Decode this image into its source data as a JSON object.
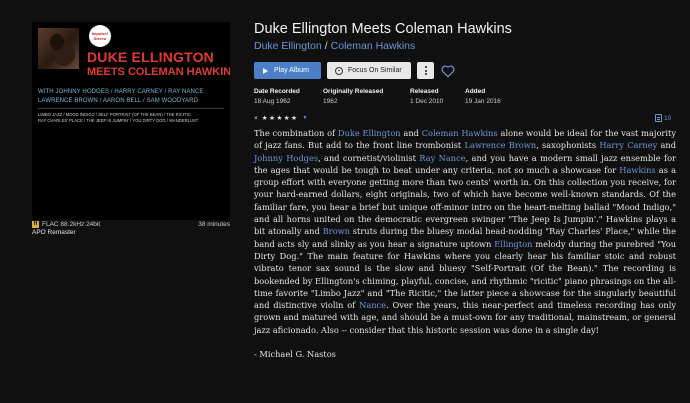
{
  "album": {
    "title": "Duke Ellington Meets Coleman Hawkins",
    "artist_1": "Duke Ellington",
    "artist_separator": "/",
    "artist_2": "Coleman Hawkins"
  },
  "cover": {
    "badge": "Impulse! Stereo",
    "title_line_1": "DUKE ELLINGTON",
    "title_line_2": "MEETS COLEMAN HAWKINS",
    "personnel_line_1": "WITH JOHNNY HODGES / HARRY CARNEY / RAY NANCE",
    "personnel_line_2": "LAWRENCE BROWN / AARON BELL / SAM WOODYARD",
    "tracks_line_1": "LIMBO JAZZ / MOOD INDIGO / SELF PORTRAIT (OF THE BEAN) / THE RICITIC",
    "tracks_line_2": "RAY CHARLES' PLACE / THE JEEP IS JUMPIN' / YOU DIRTY DOG / WANDERLUST"
  },
  "quality": {
    "hires_badge": "H",
    "format": "FLAC 88.2kHz 24bit",
    "duration": "38 minutes"
  },
  "version_label": "APO Remaster",
  "actions": {
    "play_label": "Play Album",
    "focus_label": "Focus On Similar"
  },
  "meta": [
    {
      "label": "Date Recorded",
      "value": "18 Aug 1962"
    },
    {
      "label": "Originally Released",
      "value": "1962"
    },
    {
      "label": "Released",
      "value": "1 Dec 2010"
    },
    {
      "label": "Added",
      "value": "19 Jan 2016"
    }
  ],
  "rating": {
    "clear_symbol": "×",
    "stars": 5,
    "star_glyph": "★",
    "caret": "▼"
  },
  "booklet_count": "10",
  "review": {
    "s1": "The combination of ",
    "l1": "Duke Ellington",
    "s2": " and ",
    "l2": "Coleman Hawkins",
    "s3": " alone would be ideal for the vast majority of jazz fans. But add to the front line trombonist ",
    "l3": "Lawrence Brown",
    "s4": ", saxophonists ",
    "l4": "Harry Carney",
    "s5": " and ",
    "l5": "Johnny Hodges",
    "s6": ", and cornetist/violinist ",
    "l6": "Ray Nance",
    "s7": ", and you have a modern small jazz ensemble for the ages that would be tough to beat under any criteria, not so much a showcase for ",
    "l7": "Hawkins",
    "s8": " as a group effort with everyone getting more than two cents' worth in. On this collection you receive, for your hard-earned dollars, eight originals, two of which have become well-known standards. Of the familiar fare, you hear a brief but unique off-minor intro on the heart-melting ballad \"Mood Indigo,\" and all horns united on the democratic evergreen swinger \"The Jeep Is Jumpin'.\" Hawkins plays a bit atonally and ",
    "l8": "Brown",
    "s9": " struts during the bluesy modal head-nodding \"Ray Charles' Place,\" while the band acts sly and slinky as you hear a signature uptown ",
    "l9": "Ellington",
    "s10": " melody during the purebred \"You Dirty Dog.\" The main feature for Hawkins where you clearly hear his familiar stoic and robust vibrato tenor sax sound is the slow and bluesy \"Self-Portrait (Of the Bean).\" The recording is bookended by Ellington's chiming, playful, concise, and rhythmic \"ricitic\" piano phrasings on the all-time favorite \"Limbo Jazz\" and \"The Ricitic,\" the latter piece a showcase for the singularly beautiful and distinctive violin of ",
    "l10": "Nance",
    "s11": ". Over the years, this near-perfect and timeless recording has only grown and matured with age, and should be a must-own for any traditional, mainstream, or general jazz aficionado. Also -- consider that this historic session was done in a single day!",
    "author": "- Michael G. Nastos"
  },
  "colors": {
    "background": "#101010",
    "link": "#6f95d6",
    "play_button": "#4b80c9",
    "cover_title": "#e03a33"
  },
  "icons": [
    "play-icon",
    "target-icon",
    "more-icon",
    "heart-icon",
    "booklet-icon",
    "hires-icon"
  ]
}
